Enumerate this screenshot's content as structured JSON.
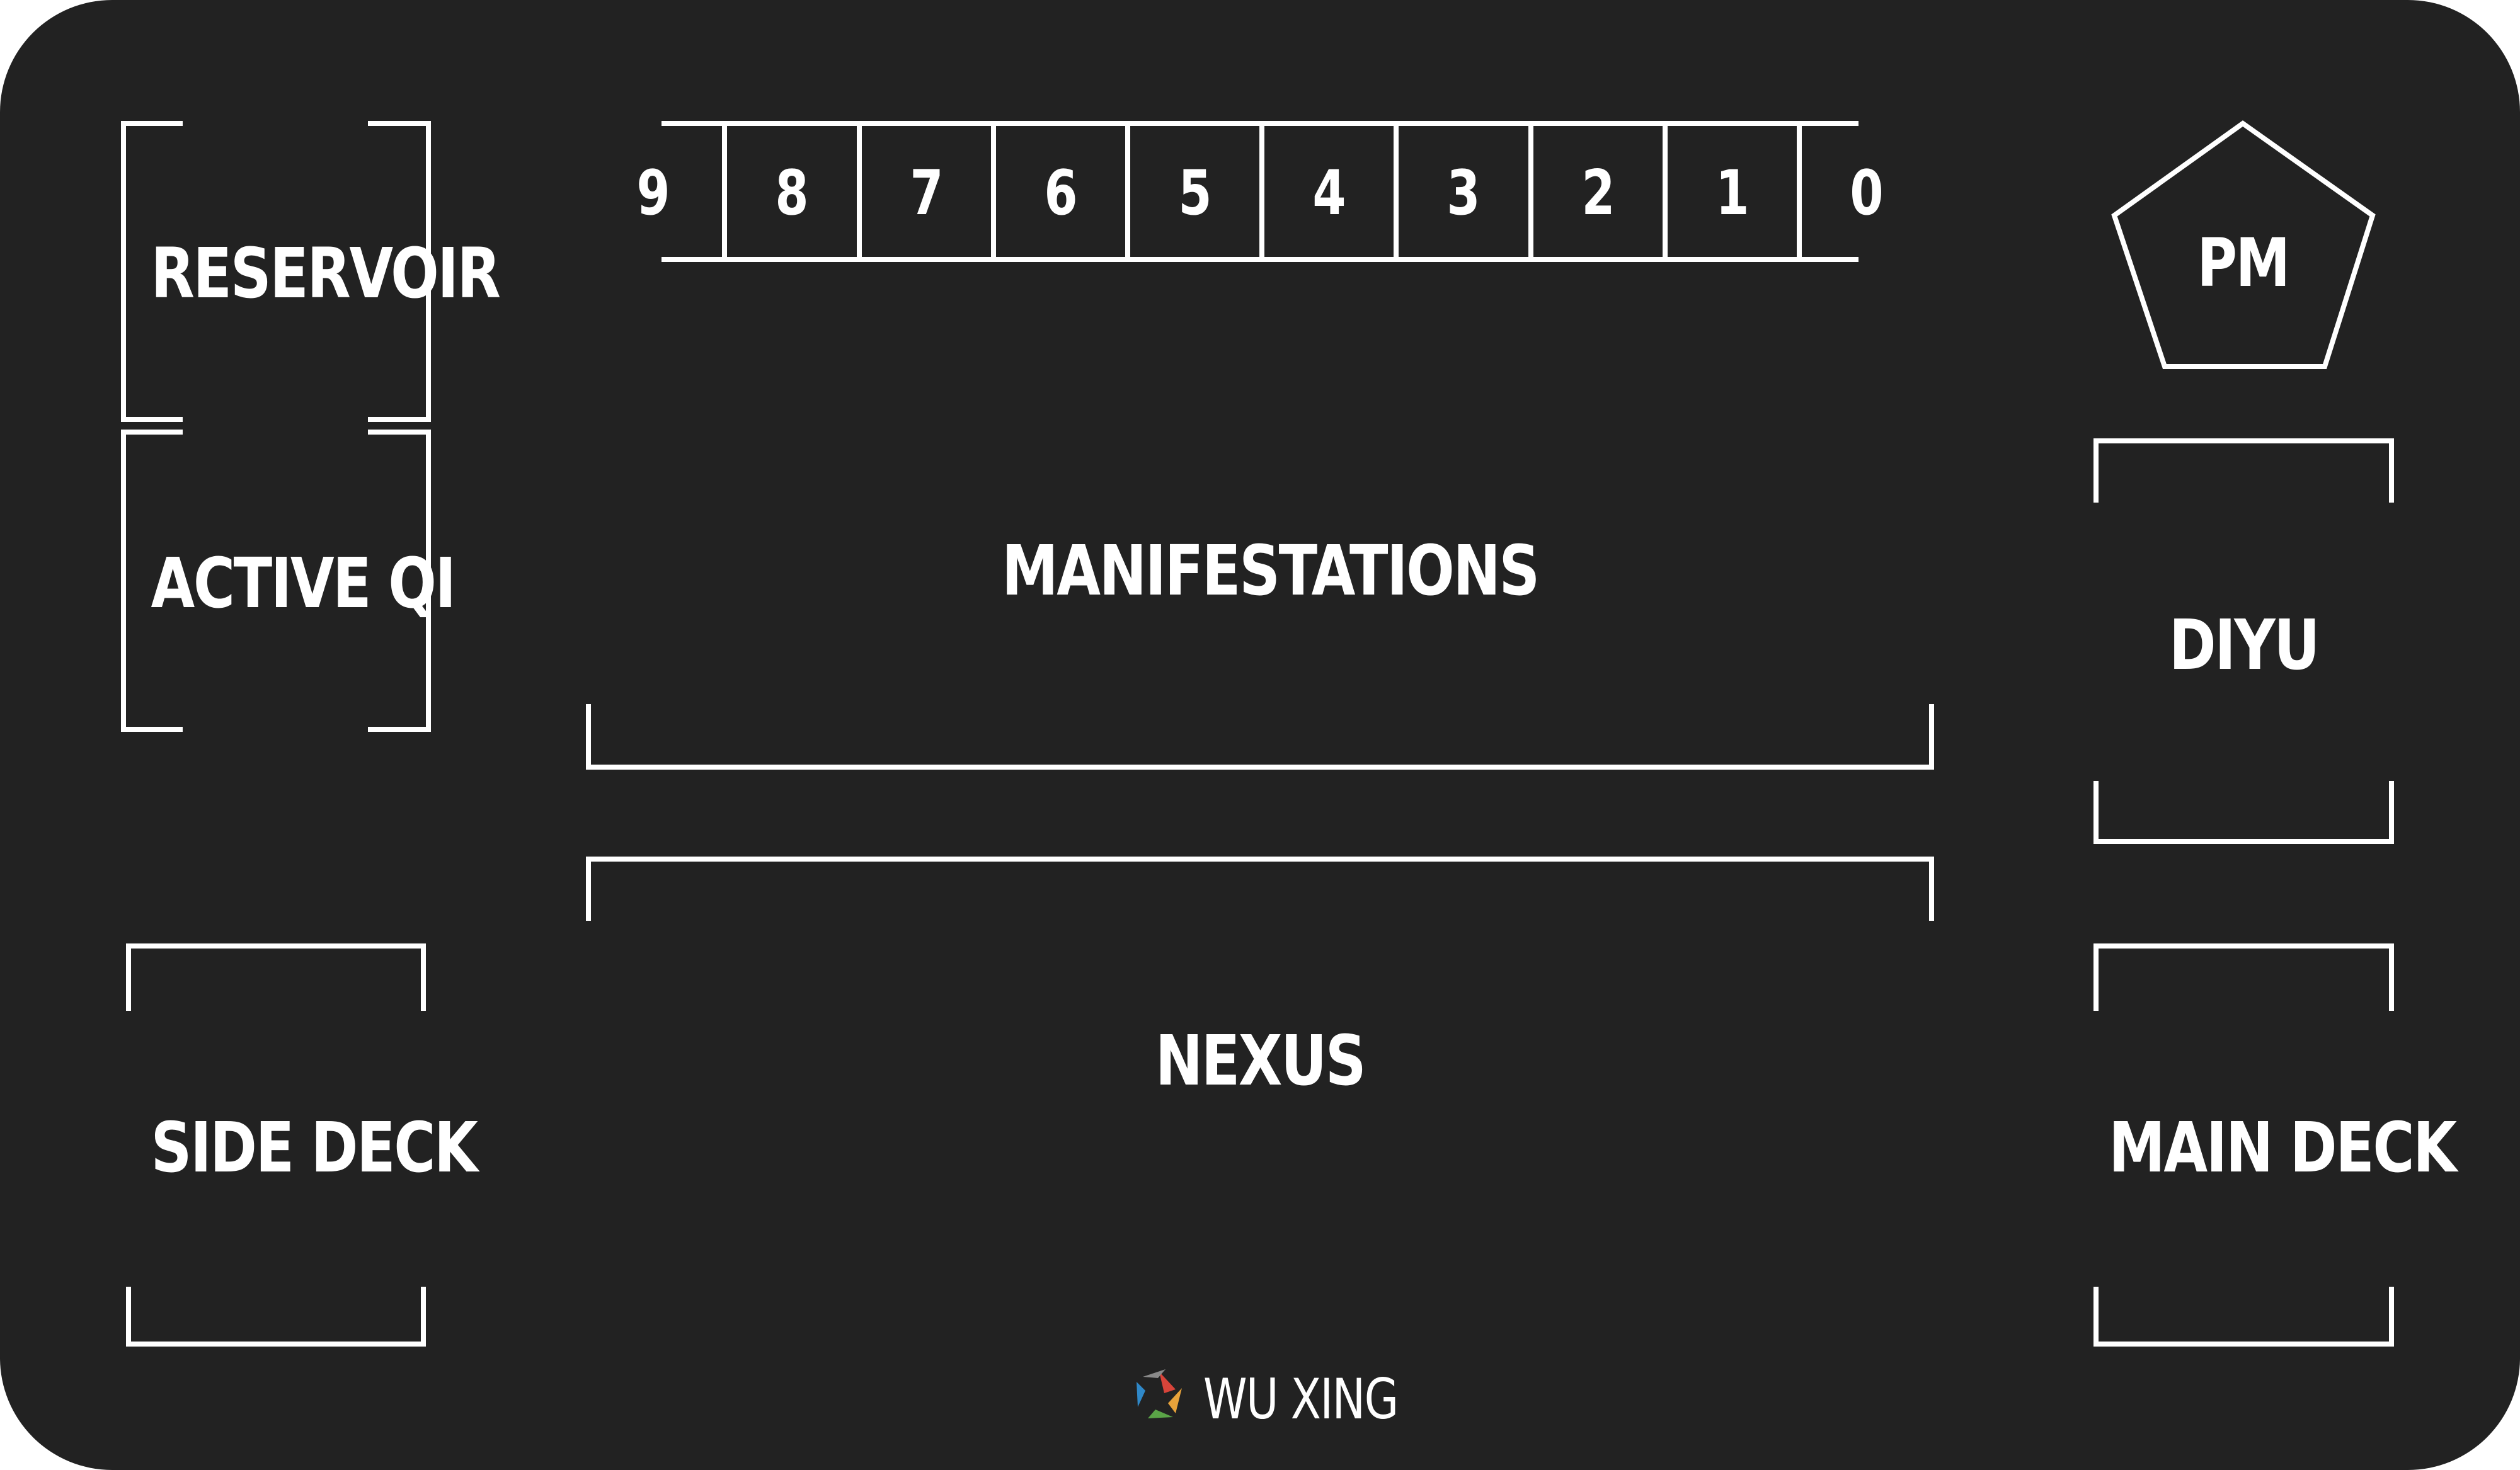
{
  "zones": {
    "reservoir": "RESERVOIR",
    "active_qi": "ACTIVE QI",
    "side_deck": "SIDE DECK",
    "manifestations": "MANIFESTATIONS",
    "nexus": "NEXUS",
    "pm": "PM",
    "diyu": "DIYU",
    "main_deck": "MAIN DECK"
  },
  "tracker": {
    "numbers": [
      "9",
      "8",
      "7",
      "6",
      "5",
      "4",
      "3",
      "2",
      "1",
      "0"
    ]
  },
  "brand": {
    "name": "WU XING",
    "icon": "wu-xing-logo-icon"
  },
  "colors": {
    "background": "#222222",
    "lines": "#ffffff",
    "logo": [
      "#d8443a",
      "#e8a23a",
      "#5aa447",
      "#2f88c8",
      "#8a8a8a"
    ]
  }
}
